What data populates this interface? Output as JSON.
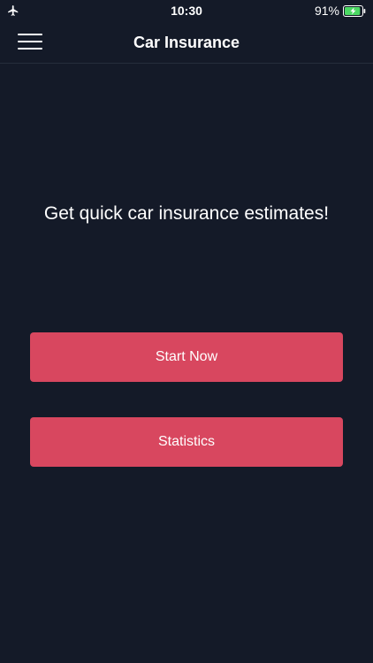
{
  "status_bar": {
    "time": "10:30",
    "battery_percent": "91%",
    "battery_level": 0.91,
    "icons": [
      "airplane-icon",
      "battery-charging-icon"
    ]
  },
  "nav": {
    "title": "Car Insurance",
    "menu_icon": "hamburger-menu-icon"
  },
  "main": {
    "headline": "Get quick car insurance estimates!",
    "start_button_label": "Start Now",
    "statistics_button_label": "Statistics"
  },
  "colors": {
    "background": "#141a28",
    "button": "#d8475f",
    "text": "#ffffff",
    "battery": "#4cd964"
  }
}
